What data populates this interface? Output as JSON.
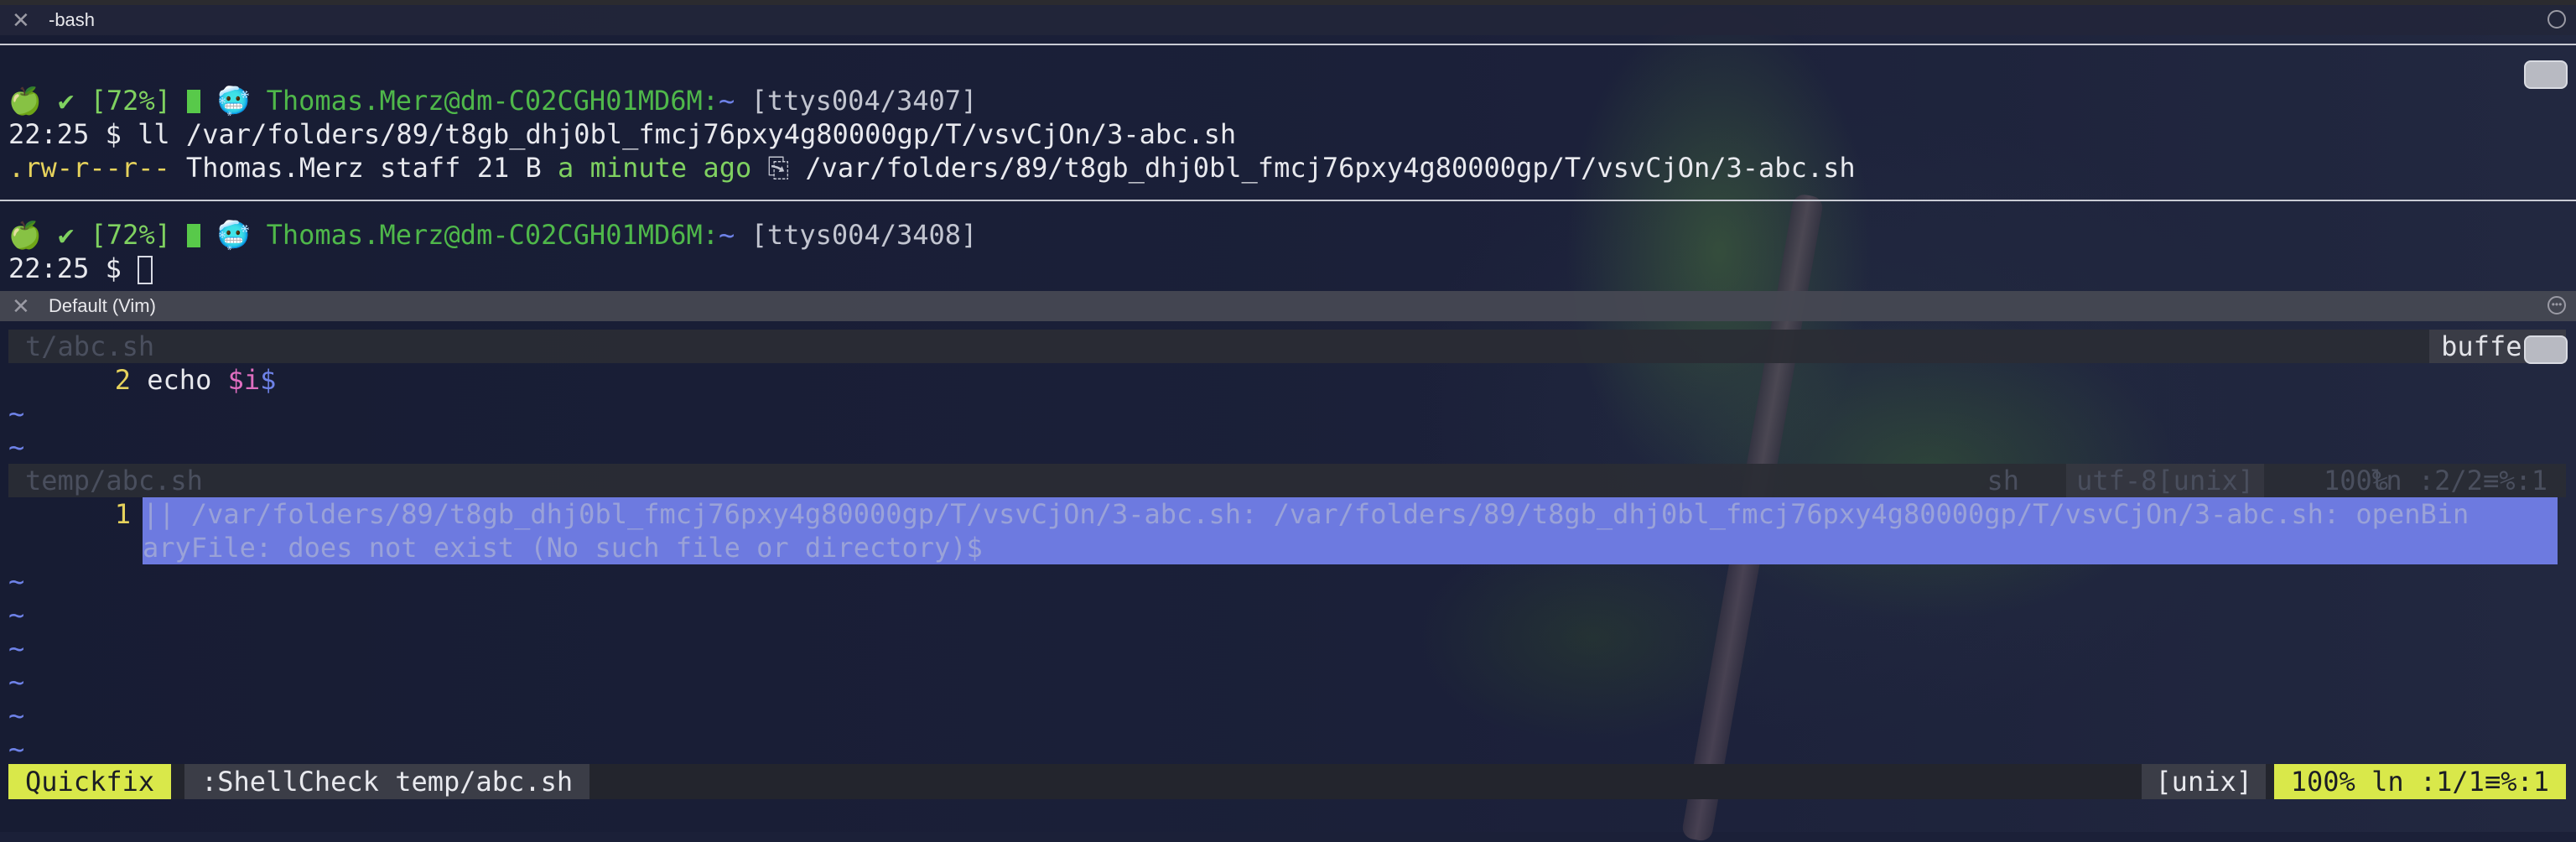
{
  "window": {
    "pane1_title": "-bash",
    "pane2_title": "Default (Vim)",
    "close_glyph": "✕",
    "more_glyph": "···"
  },
  "terminal": {
    "prompt1": {
      "icons": "🍏 ✔",
      "battery": "[72%]",
      "user_host": "Thomas.Merz@dm-C02CGH01MD6M:",
      "cwd": "~",
      "tty": "[ttys004/3407]"
    },
    "cmd1": {
      "time": "22:25",
      "symbol": "$",
      "command": "ll /var/folders/89/t8gb_dhj0bl_fmcj76pxy4g80000gp/T/vsvCjOn/3-abc.sh"
    },
    "listing": {
      "perms": ".rw-r--r--",
      "owner": "Thomas.Merz",
      "group": "staff",
      "size": "21 B",
      "modified": "a minute ago",
      "file_icon": "⎘",
      "path": "/var/folders/89/t8gb_dhj0bl_fmcj76pxy4g80000gp/T/vsvCjOn/3-abc.sh"
    },
    "prompt2": {
      "icons": "🍏 ✔",
      "battery": "[72%]",
      "user_host": "Thomas.Merz@dm-C02CGH01MD6M:",
      "cwd": "~",
      "tty": "[ttys004/3408]"
    },
    "cmd2": {
      "time": "22:25",
      "symbol": "$"
    }
  },
  "vim": {
    "top_buffer_name": "t/abc.sh",
    "buffers_label": "buffers",
    "code_line": {
      "number": "2",
      "keyword": "echo",
      "variable": "$i",
      "eol": "$"
    },
    "tilde": "~",
    "quickfix_header": {
      "name": "temp/abc.sh",
      "filetype": "sh",
      "encoding": "utf-8[unix]",
      "percent": "100%",
      "position": "ln :2/2≡%:1"
    },
    "quickfix_entry": {
      "number": "1",
      "line1": "|| /var/folders/89/t8gb_dhj0bl_fmcj76pxy4g80000gp/T/vsvCjOn/3-abc.sh: /var/folders/89/t8gb_dhj0bl_fmcj76pxy4g80000gp/T/vsvCjOn/3-abc.sh: openBin",
      "line2": "aryFile: does not exist (No such file or directory)$"
    },
    "statusline": {
      "mode": "Quickfix",
      "command": ":ShellCheck temp/abc.sh",
      "format": "[unix]",
      "percent": "100%",
      "position": "ln :1/1≡%:1"
    }
  },
  "colors": {
    "prompt_green": "#7fd160",
    "selection": "#6d7ae0",
    "statusline_accent": "#d9e84a",
    "tilde_blue": "#6e82e8"
  }
}
